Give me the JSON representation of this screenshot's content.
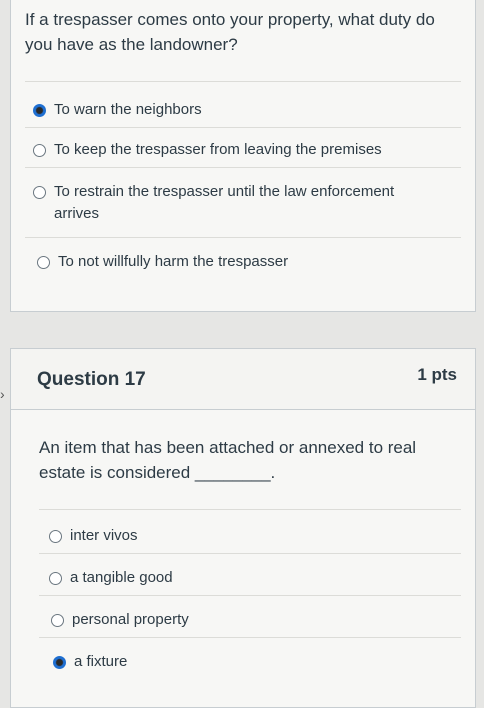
{
  "q16": {
    "question": "If a trespasser comes onto your property, what duty do you have as the landowner?",
    "answers": [
      {
        "label": "To warn the neighbors",
        "selected": true
      },
      {
        "label": "To keep the trespasser from leaving the premises",
        "selected": false
      },
      {
        "label": "To restrain the trespasser until the law enforcement arrives",
        "selected": false
      },
      {
        "label": "To not willfully harm the trespasser",
        "selected": false
      }
    ]
  },
  "q17": {
    "title": "Question 17",
    "points": "1 pts",
    "question": "An item that has been attached or annexed to real estate is considered ________.",
    "answers": [
      {
        "label": "inter vivos",
        "selected": false
      },
      {
        "label": "a tangible good",
        "selected": false
      },
      {
        "label": "personal property",
        "selected": false
      },
      {
        "label": "a fixture",
        "selected": true
      }
    ]
  },
  "colors": {
    "accent": "#1f6fd1",
    "text": "#2d3b45"
  },
  "icons": {
    "left_marker": "chevron-right-icon"
  }
}
